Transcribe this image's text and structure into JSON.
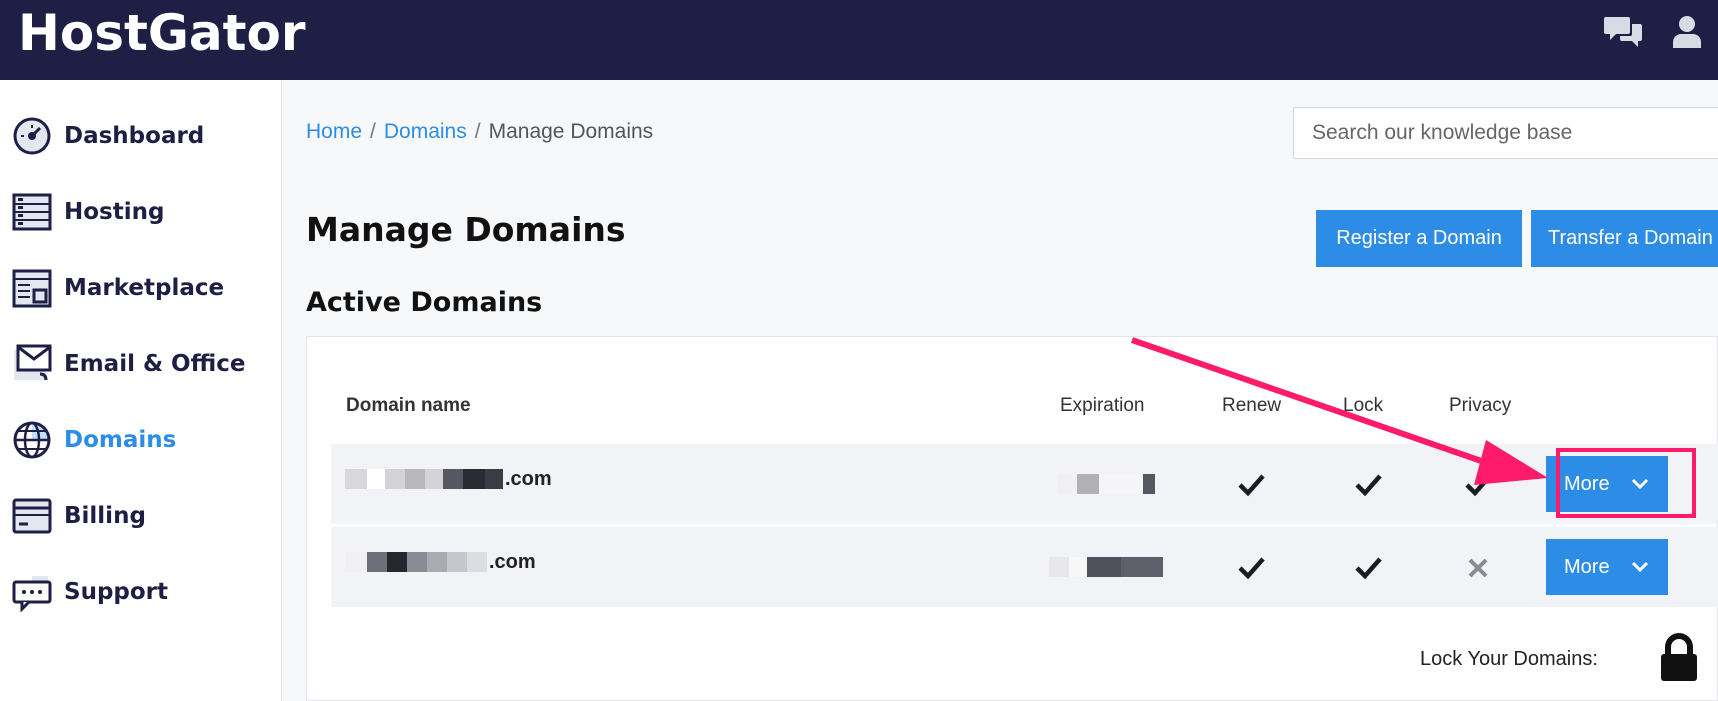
{
  "brand": {
    "logo": "HostGator"
  },
  "topbar": {
    "chat_icon": "chat-bubbles-icon",
    "user_icon": "user-icon"
  },
  "sidebar": {
    "items": [
      {
        "label": "Dashboard",
        "icon": "dashboard-gauge-icon"
      },
      {
        "label": "Hosting",
        "icon": "hosting-server-icon"
      },
      {
        "label": "Marketplace",
        "icon": "marketplace-icon"
      },
      {
        "label": "Email & Office",
        "icon": "email-icon"
      },
      {
        "label": "Domains",
        "icon": "globe-icon",
        "active": true
      },
      {
        "label": "Billing",
        "icon": "billing-icon"
      },
      {
        "label": "Support",
        "icon": "support-chat-icon"
      }
    ]
  },
  "breadcrumb": {
    "home": "Home",
    "domains": "Domains",
    "current": "Manage Domains",
    "separator": "/"
  },
  "search": {
    "placeholder": "Search our knowledge base"
  },
  "header": {
    "title": "Manage Domains",
    "register_label": "Register a Domain",
    "transfer_label": "Transfer a Domain"
  },
  "active_domains": {
    "title": "Active Domains",
    "columns": {
      "domain": "Domain name",
      "expiration": "Expiration",
      "renew": "Renew",
      "lock": "Lock",
      "privacy": "Privacy"
    },
    "rows": [
      {
        "domain_suffix": ".com",
        "renew": true,
        "lock": true,
        "privacy": true,
        "more_label": "More"
      },
      {
        "domain_suffix": ".com",
        "renew": true,
        "lock": true,
        "privacy": false,
        "more_label": "More"
      }
    ]
  },
  "lock_domains": {
    "label": "Lock Your Domains:"
  },
  "colors": {
    "accent": "#2d8de6",
    "topbar": "#1f1f45",
    "annotation": "#ff1a6a"
  }
}
